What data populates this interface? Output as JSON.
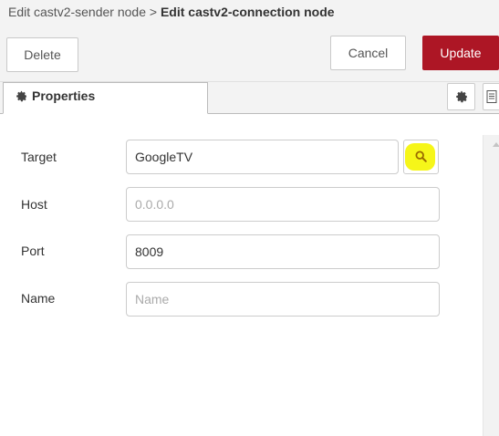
{
  "breadcrumb": {
    "parent": "Edit castv2-sender node",
    "separator": ">",
    "current": "Edit castv2-connection node"
  },
  "toolbar": {
    "delete_label": "Delete",
    "cancel_label": "Cancel",
    "update_label": "Update"
  },
  "tabs": {
    "properties_label": "Properties",
    "icons": [
      "gear-icon",
      "gear-icon",
      "document-icon"
    ]
  },
  "form": {
    "target": {
      "label": "Target",
      "value": "GoogleTV",
      "button_icon": "search-icon"
    },
    "host": {
      "label": "Host",
      "value": "",
      "placeholder": "0.0.0.0"
    },
    "port": {
      "label": "Port",
      "value": "8009"
    },
    "name": {
      "label": "Name",
      "value": "",
      "placeholder": "Name"
    }
  },
  "colors": {
    "update_button": "#ad1625",
    "search_highlight": "#f6f619",
    "header_bg": "#f3f3f3"
  }
}
